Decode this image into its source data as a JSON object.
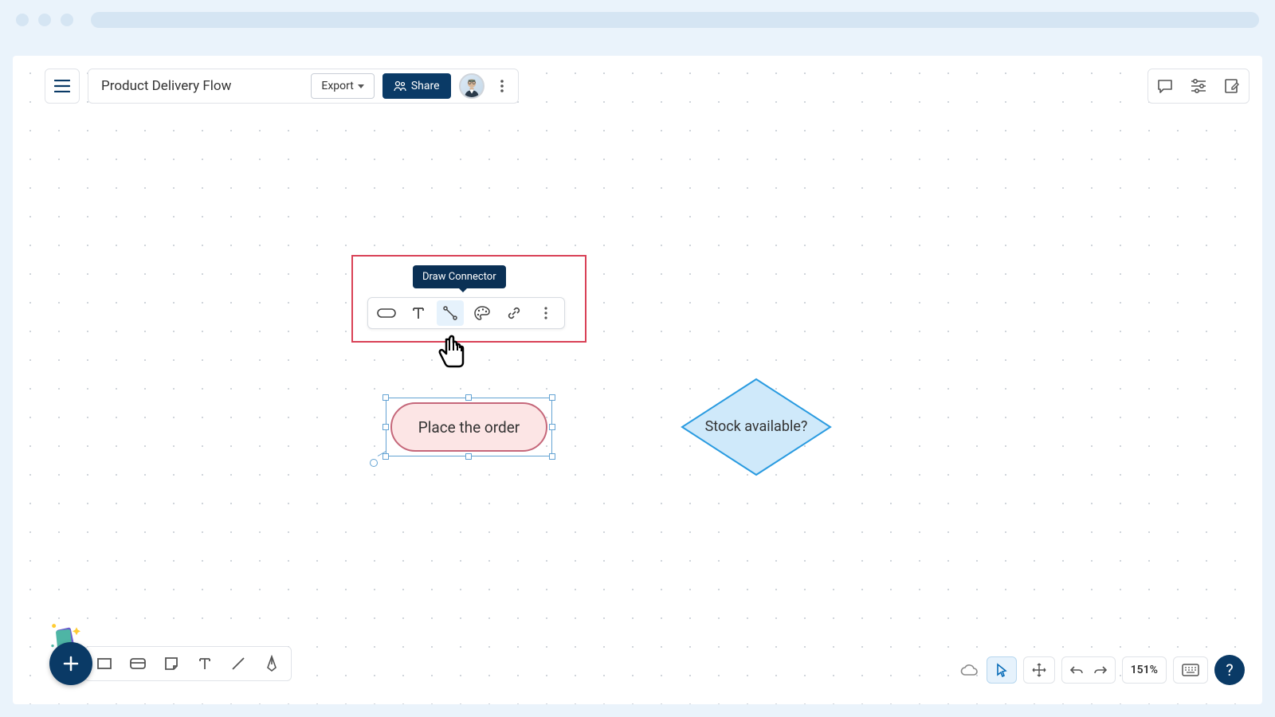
{
  "header": {
    "title": "Product Delivery Flow",
    "export_label": "Export",
    "share_label": "Share"
  },
  "tooltip": {
    "draw_connector": "Draw Connector"
  },
  "shapes": {
    "terminator_text": "Place the order",
    "decision_text": "Stock available?"
  },
  "footer": {
    "zoom_label": "151%"
  }
}
